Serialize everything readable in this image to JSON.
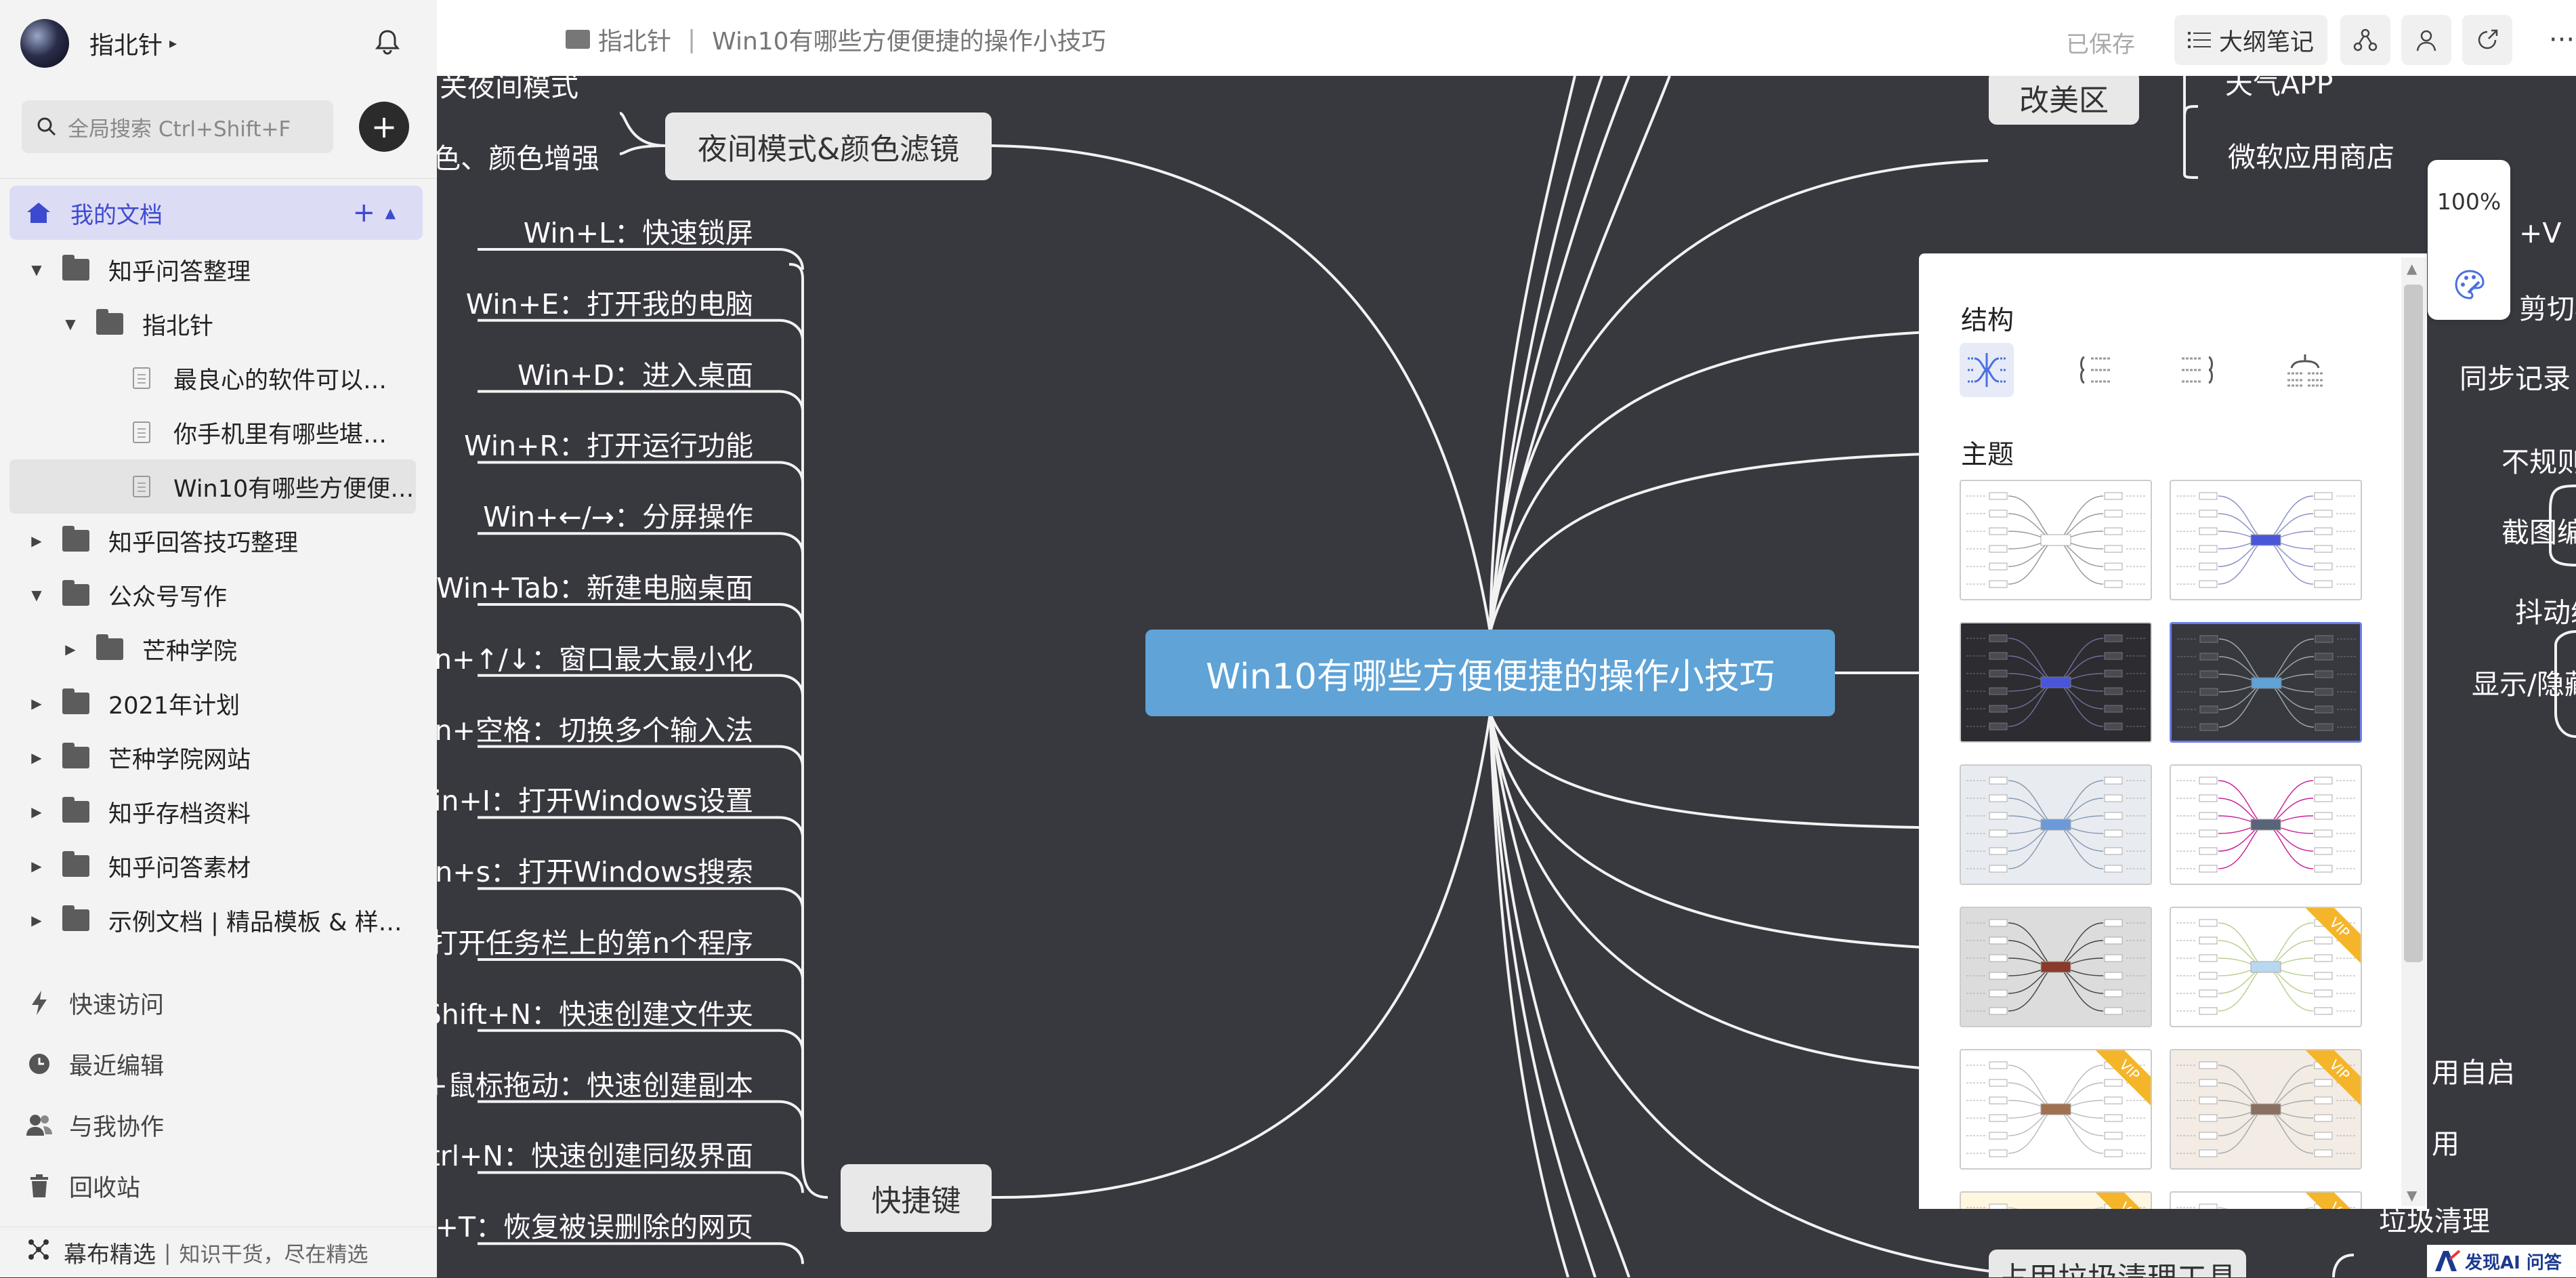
{
  "sidebar": {
    "user_name": "指北针",
    "search_placeholder": "全局搜索 Ctrl+Shift+F",
    "my_docs": "我的文档",
    "tree": [
      {
        "label": "知乎问答整理",
        "type": "folder",
        "level": 0,
        "expanded": true
      },
      {
        "label": "指北针",
        "type": "folder",
        "level": 1,
        "expanded": true
      },
      {
        "label": "最良心的软件可以…",
        "type": "doc",
        "level": 2
      },
      {
        "label": "你手机里有哪些堪…",
        "type": "doc",
        "level": 2
      },
      {
        "label": "Win10有哪些方便便…",
        "type": "doc",
        "level": 2,
        "selected": true
      },
      {
        "label": "知乎回答技巧整理",
        "type": "folder",
        "level": 0,
        "expanded": false
      },
      {
        "label": "公众号写作",
        "type": "folder",
        "level": 0,
        "expanded": true
      },
      {
        "label": "芒种学院",
        "type": "folder",
        "level": 1,
        "expanded": false
      },
      {
        "label": "2021年计划",
        "type": "folder",
        "level": 0,
        "expanded": false
      },
      {
        "label": "芒种学院网站",
        "type": "folder",
        "level": 0,
        "expanded": false
      },
      {
        "label": "知乎存档资料",
        "type": "folder",
        "level": 0,
        "expanded": false
      },
      {
        "label": "知乎问答素材",
        "type": "folder",
        "level": 0,
        "expanded": false
      },
      {
        "label": "示例文档 | 精品模板 & 样…",
        "type": "folder",
        "level": 0,
        "expanded": false
      }
    ],
    "nav": {
      "quick": "快速访问",
      "recent": "最近编辑",
      "collab": "与我协作",
      "trash": "回收站"
    },
    "footer_brand": "幕布精选",
    "footer_tagline": "知识干货，尽在精选"
  },
  "topbar": {
    "crumb_folder": "指北针",
    "crumb_doc": "Win10有哪些方便便捷的操作小技巧",
    "saved": "已保存",
    "outline": "大纲笔记",
    "more": "···"
  },
  "mindmap": {
    "central": "Win10有哪些方便便捷的操作小技巧",
    "branch_night": "夜间模式&颜色滤镜",
    "branch_shortcut": "快捷键",
    "branch_beautify": "改美区",
    "night_children": [
      "关夜间模式",
      "色、颜色增强"
    ],
    "shortcuts": [
      "Win+L：快速锁屏",
      "Win+E：打开我的电脑",
      "Win+D：进入桌面",
      "Win+R：打开运行功能",
      "Win+←/→：分屏操作",
      "Win+Tab：新建电脑桌面",
      "Win+↑/↓：窗口最大最小化",
      "Win+空格：切换多个输入法",
      "Win+I：打开Windows设置",
      "Win+s：打开Windows搜索",
      "打开任务栏上的第n个程序",
      "+Shift+N：快速创建文件夹",
      "+鼠标拖动：快速创建副本",
      "Ctrl+N：快速创建同级界面",
      "ft+T：恢复被误删除的网页"
    ],
    "right_top": [
      "天气APP",
      "微软应用商店"
    ],
    "right_side": [
      "+V",
      "剪切板",
      "同步记录",
      "不规则",
      "截图编",
      "抖动缩小",
      "显示/隐藏",
      "用自启",
      "用",
      "垃圾清理"
    ],
    "bottom_partial": "占用垃圾清理工具"
  },
  "zoom": {
    "value": "100%"
  },
  "panel": {
    "structure_title": "结构",
    "theme_title": "主题",
    "vip_label": "VIP"
  },
  "watermark": "发现AI 问答"
}
